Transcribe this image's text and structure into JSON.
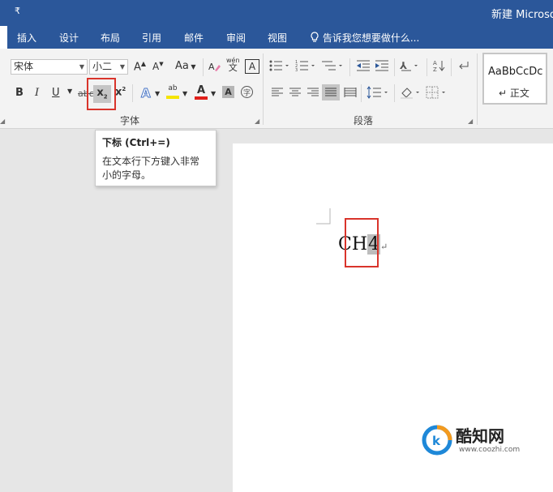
{
  "window": {
    "qat_symbol": "₹",
    "title": "新建 Microso"
  },
  "tabs": [
    "插入",
    "设计",
    "布局",
    "引用",
    "邮件",
    "审阅",
    "视图"
  ],
  "tell_me": "告诉我您想要做什么...",
  "font": {
    "name": "宋体",
    "size": "小二",
    "grow": "A",
    "shrink": "A",
    "change_case": "Aa",
    "phonetic_top": "wén",
    "phonetic_bottom": "文",
    "border_char": "A",
    "bold": "B",
    "italic": "I",
    "underline": "U",
    "strikethrough": "abc",
    "subscript": "x",
    "subscript_sub": "2",
    "superscript": "x",
    "superscript_sup": "2",
    "highlight_label": "ab",
    "group_label": "字体",
    "colors": {
      "font_color": "#e0201b",
      "highlight": "#f5e400",
      "text_effects": "#4472c4"
    }
  },
  "paragraph": {
    "group_label": "段落"
  },
  "styles": {
    "preview": "AaBbCcDc",
    "name": "↵ 正文"
  },
  "tooltip": {
    "title": "下标 (Ctrl+=)",
    "desc_line1": "在文本行下方键入非常",
    "desc_line2": "小的字母。"
  },
  "document": {
    "text_main": "CH",
    "text_sub": "4",
    "para_mark": "↵"
  },
  "watermark": {
    "brand": "酷知网",
    "url": "www.coozhi.com"
  },
  "accent": {
    "ribbon_blue": "#2b579a",
    "highlight_red": "#d9342b",
    "brand_orange": "#f39a1e",
    "brand_blue": "#1e88d8"
  }
}
